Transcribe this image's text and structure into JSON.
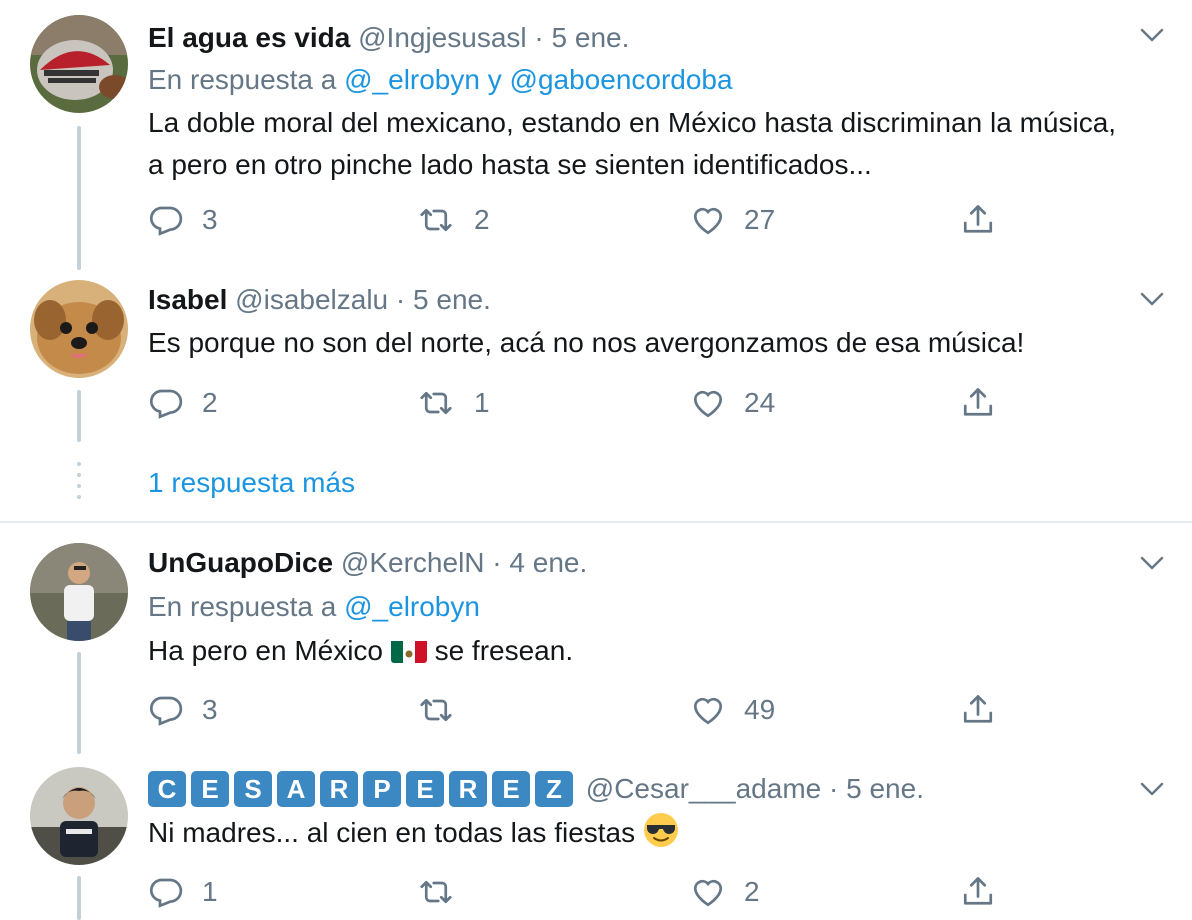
{
  "tweets": [
    {
      "name": "El agua es vida",
      "handle": "@Ingjesusasl",
      "sep": "·",
      "date": "5 ene.",
      "reply_prefix": "En respuesta a",
      "reply_to_1": "@_elrobyn",
      "reply_and": "y",
      "reply_to_2": "@gaboencordoba",
      "text": "La doble moral del mexicano, estando en México hasta discriminan la música, a pero en otro pinche lado hasta se sienten identificados...",
      "replies": "3",
      "retweets": "2",
      "likes": "27"
    },
    {
      "name": "Isabel",
      "handle": "@isabelzalu",
      "sep": "·",
      "date": "5 ene.",
      "text": "Es porque no son del norte, acá no nos avergonzamos de esa música!",
      "replies": "2",
      "retweets": "1",
      "likes": "24"
    },
    {
      "name": "UnGuapoDice",
      "handle": "@KerchelN",
      "sep": "·",
      "date": "4 ene.",
      "reply_prefix": "En respuesta a",
      "reply_to_1": "@_elrobyn",
      "text_before": "Ha pero en México",
      "text_after": "se fresean.",
      "replies": "3",
      "retweets": "",
      "likes": "49"
    },
    {
      "name_letters": [
        "C",
        "E",
        "S",
        "A",
        "R",
        "P",
        "E",
        "R",
        "E",
        "Z"
      ],
      "handle": "@Cesar___adame",
      "sep": "·",
      "date": "5 ene.",
      "text": "Ni madres... al cien en todas las fiestas",
      "replies": "1",
      "retweets": "",
      "likes": "2"
    }
  ],
  "more_replies": "1 respuesta más",
  "icons": {
    "reply": "reply-icon",
    "retweet": "retweet-icon",
    "like": "heart-icon",
    "share": "share-icon",
    "menu": "chevron-down-icon"
  },
  "colors": {
    "link": "#1b95e0",
    "muted": "#657786",
    "badge": "#3b88c3"
  }
}
